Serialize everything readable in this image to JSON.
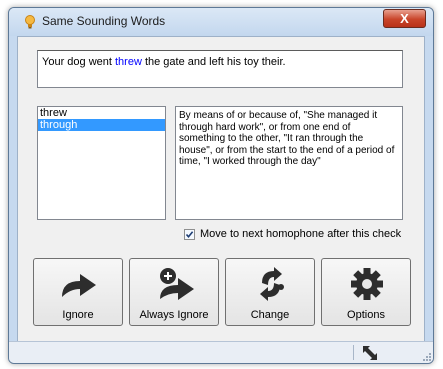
{
  "window": {
    "title": "Same Sounding Words",
    "close_label": "X"
  },
  "sentence": {
    "before": "Your dog went ",
    "highlight": "threw",
    "after": " the gate and left his toy their."
  },
  "homophones": [
    {
      "word": "threw",
      "selected": false
    },
    {
      "word": "through",
      "selected": true
    }
  ],
  "definition": "By means of or because of, \"She managed it through hard work\", or from one end of something to the other, \"It ran through the house\", or from the start to the end of a period of time, \"I worked through the day\"",
  "move_next": {
    "label": "Move to next homophone after this check",
    "checked": true
  },
  "buttons": {
    "ignore": "Ignore",
    "always_ignore": "Always Ignore",
    "change": "Change",
    "options": "Options"
  },
  "colors": {
    "highlight_word": "#0000ff",
    "selection": "#3399ff",
    "window_frame": "#c6d9ef"
  },
  "icons": {
    "app": "lightbulb-icon",
    "ignore": "arrow-right-icon",
    "always_ignore": "plus-arrow-icon",
    "change": "swap-arrows-icon",
    "options": "gear-icon",
    "status": "resize-arrows-icon"
  }
}
